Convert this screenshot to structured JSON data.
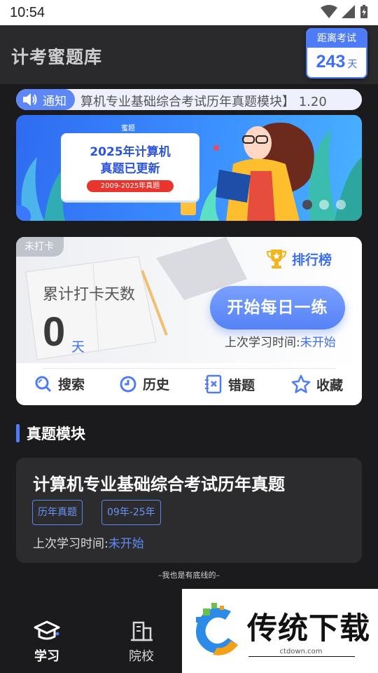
{
  "status_bar": {
    "time": "10:54"
  },
  "header": {
    "title": "计考蜜题库",
    "countdown": {
      "label": "距离考试",
      "value": "243",
      "unit": "天"
    }
  },
  "notice": {
    "tag": "通知",
    "text": "算机专业基础综合考试历年真题模块】 1.20"
  },
  "banner": {
    "small_text": "蜜题",
    "line1": "2025年计算机",
    "line2": "真题已更新",
    "pill": "2009-2025年真题",
    "slide_count": 3,
    "active_slide": 1
  },
  "checkin": {
    "badge": "未打卡",
    "rank_label": "排行榜",
    "label": "累计打卡天数",
    "days": "0",
    "unit": "天",
    "start_button": "开始每日一练",
    "last_study_prefix": "上次学习时间:",
    "last_study_value": "未开始",
    "actions": [
      {
        "label": "搜索",
        "icon": "search-icon"
      },
      {
        "label": "历史",
        "icon": "clock-icon"
      },
      {
        "label": "错题",
        "icon": "wrong-notebook-icon"
      },
      {
        "label": "收藏",
        "icon": "star-icon"
      }
    ]
  },
  "section": {
    "title": "真题模块"
  },
  "module": {
    "title": "计算机专业基础综合考试历年真题",
    "tags": [
      "历年真题",
      "09年-25年"
    ],
    "last_study_prefix": "上次学习时间:",
    "last_study_value": "未开始"
  },
  "footer_note": "–我也是有底线的–",
  "bottom_nav": [
    {
      "label": "学习",
      "icon": "graduation-cap-icon",
      "active": true
    },
    {
      "label": "院校",
      "icon": "building-icon",
      "active": false
    }
  ],
  "watermark": {
    "text": "传统下载",
    "url": "ctdown.com"
  },
  "colors": {
    "accent": "#4d7cf6",
    "background": "#1b1b1d",
    "card": "#2c2c2e"
  }
}
